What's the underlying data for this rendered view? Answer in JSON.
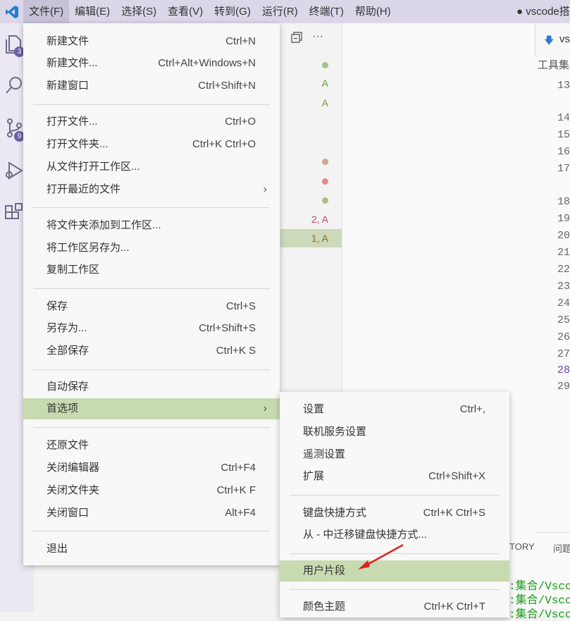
{
  "menubar": {
    "items": [
      "文件(F)",
      "编辑(E)",
      "选择(S)",
      "查看(V)",
      "转到(G)",
      "运行(R)",
      "终端(T)",
      "帮助(H)"
    ],
    "window_title": "● vscode搭"
  },
  "activity": {
    "explorer_badge": "3",
    "scm_badge": "9"
  },
  "sidebar": {
    "statuses": [
      "A",
      "A",
      "2, A",
      "1, A"
    ]
  },
  "editor": {
    "tab_label": "vs",
    "breadcrumb": "工具集",
    "line_numbers": [
      "13",
      "14",
      "15",
      "16",
      "17",
      "18",
      "19",
      "20",
      "21",
      "22",
      "23",
      "24",
      "25",
      "26",
      "27",
      "28",
      "29"
    ]
  },
  "panel": {
    "tab1": "TORY",
    "tab2": "问题",
    "terminal_lines": [
      ":集合/Vscod",
      ":集合/Vscod",
      ":集合/Vscod"
    ]
  },
  "file_menu": {
    "items": [
      {
        "label": "新建文件",
        "shortcut": "Ctrl+N"
      },
      {
        "label": "新建文件...",
        "shortcut": "Ctrl+Alt+Windows+N"
      },
      {
        "label": "新建窗口",
        "shortcut": "Ctrl+Shift+N"
      },
      {
        "label": "打开文件...",
        "shortcut": "Ctrl+O"
      },
      {
        "label": "打开文件夹...",
        "shortcut": "Ctrl+K Ctrl+O"
      },
      {
        "label": "从文件打开工作区...",
        "shortcut": ""
      },
      {
        "label": "打开最近的文件",
        "shortcut": ""
      },
      {
        "label": "将文件夹添加到工作区...",
        "shortcut": ""
      },
      {
        "label": "将工作区另存为...",
        "shortcut": ""
      },
      {
        "label": "复制工作区",
        "shortcut": ""
      },
      {
        "label": "保存",
        "shortcut": "Ctrl+S"
      },
      {
        "label": "另存为...",
        "shortcut": "Ctrl+Shift+S"
      },
      {
        "label": "全部保存",
        "shortcut": "Ctrl+K S"
      },
      {
        "label": "自动保存",
        "shortcut": ""
      },
      {
        "label": "首选项",
        "shortcut": ""
      },
      {
        "label": "还原文件",
        "shortcut": ""
      },
      {
        "label": "关闭编辑器",
        "shortcut": "Ctrl+F4"
      },
      {
        "label": "关闭文件夹",
        "shortcut": "Ctrl+K F"
      },
      {
        "label": "关闭窗口",
        "shortcut": "Alt+F4"
      },
      {
        "label": "退出",
        "shortcut": ""
      }
    ]
  },
  "prefs_menu": {
    "items": [
      {
        "label": "设置",
        "shortcut": "Ctrl+,"
      },
      {
        "label": "联机服务设置",
        "shortcut": ""
      },
      {
        "label": "遥测设置",
        "shortcut": ""
      },
      {
        "label": "扩展",
        "shortcut": "Ctrl+Shift+X"
      },
      {
        "label": "键盘快捷方式",
        "shortcut": "Ctrl+K Ctrl+S"
      },
      {
        "label": "从 - 中迁移键盘快捷方式...",
        "shortcut": ""
      },
      {
        "label": "用户片段",
        "shortcut": ""
      },
      {
        "label": "颜色主题",
        "shortcut": "Ctrl+K Ctrl+T"
      }
    ]
  },
  "colors": {
    "menu_highlight": "#c8dab0",
    "arrow": "#e02020",
    "badge": "#6a5fa5",
    "status_added": "#6a9f3a",
    "status_modified": "#c9ab86",
    "status_deleted": "#e08c8c"
  }
}
